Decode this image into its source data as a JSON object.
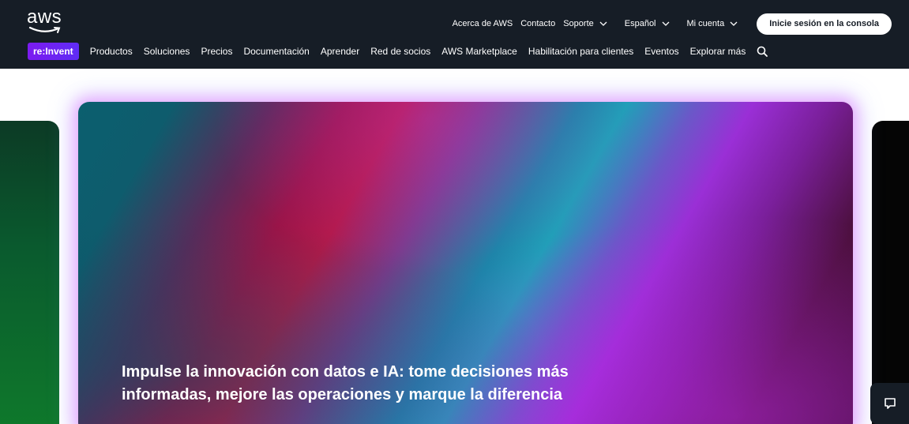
{
  "header": {
    "logo_text": "aws",
    "utility_links": {
      "about": "Acerca de AWS",
      "contact": "Contacto",
      "support": "Soporte",
      "language": "Español",
      "account": "Mi cuenta"
    },
    "console_button": "Inicie sesión en la consola",
    "badge": "re:Invent",
    "nav_items": [
      "Productos",
      "Soluciones",
      "Precios",
      "Documentación",
      "Aprender",
      "Red de socios",
      "AWS Marketplace",
      "Habilitación para clientes",
      "Eventos",
      "Explorar más"
    ]
  },
  "hero": {
    "title_line1": "Impulse la innovación con datos e IA: tome decisiones más",
    "title_line2": "informadas, mejore las operaciones y marque la diferencia"
  },
  "colors": {
    "nav_bg": "#161d26",
    "badge": "#7c1bf0",
    "text": "#ffffff"
  },
  "icons": [
    "aws-smile-icon",
    "chevron-down-icon",
    "search-icon",
    "chat-icon"
  ]
}
